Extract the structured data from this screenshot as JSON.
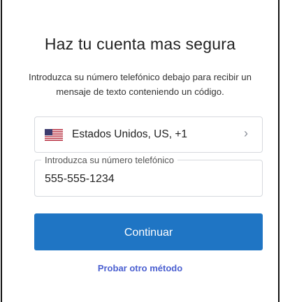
{
  "title": "Haz tu cuenta mas segura",
  "subtitle": "Introduzca su número telefónico debajo para recibir un mensaje de texto conteniendo un código.",
  "country_selector": {
    "label": "Estados Unidos, US, +1",
    "flag_icon": "us-flag-icon",
    "chevron": "›"
  },
  "phone_field": {
    "label": "Introduzca su número telefónico",
    "value": "555-555-1234"
  },
  "continue_label": "Continuar",
  "alt_method_label": "Probar otro método",
  "colors": {
    "primary": "#1f75c4",
    "link": "#4a5fd0",
    "border": "#d6d9de"
  }
}
